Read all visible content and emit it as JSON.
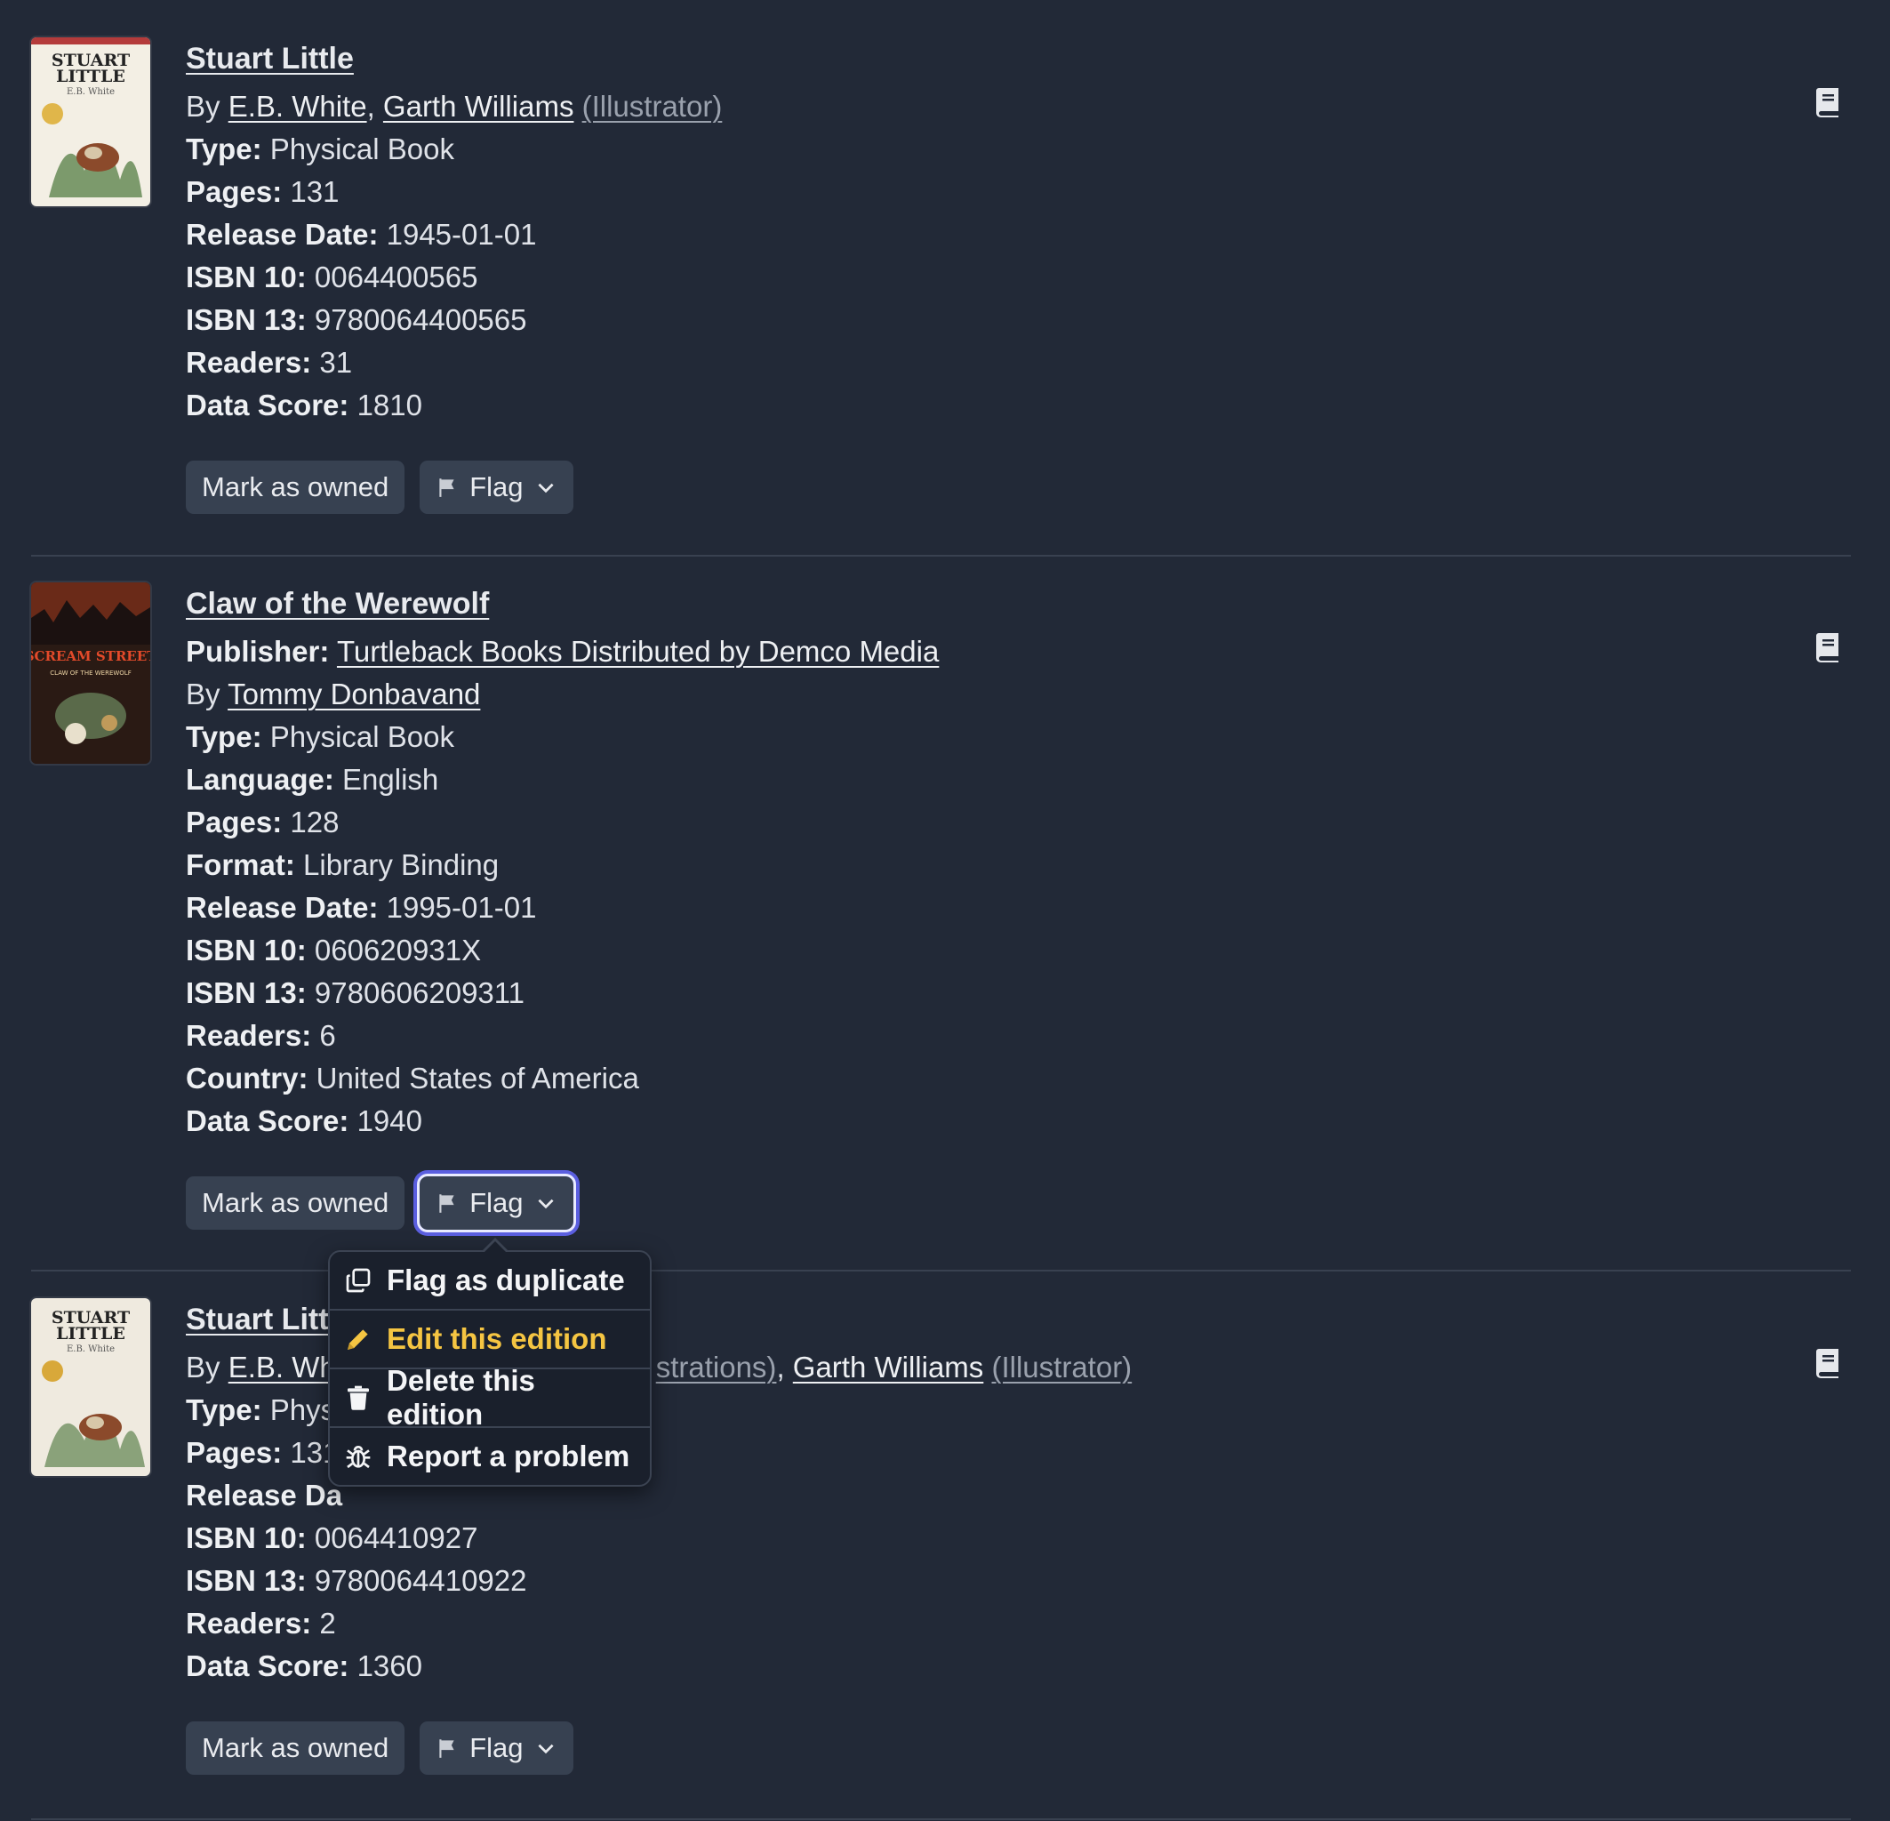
{
  "editions": [
    {
      "title": "Stuart Little",
      "by_label": "By",
      "authors": [
        {
          "name": "E.B. White",
          "role": ""
        },
        {
          "name": "Garth Williams",
          "role": "(Illustrator)"
        }
      ],
      "fields": [
        {
          "label": "Type:",
          "value": "Physical Book"
        },
        {
          "label": "Pages:",
          "value": "131"
        },
        {
          "label": "Release Date:",
          "value": "1945-01-01"
        },
        {
          "label": "ISBN 10:",
          "value": "0064400565"
        },
        {
          "label": "ISBN 13:",
          "value": "9780064400565"
        },
        {
          "label": "Readers:",
          "value": "31"
        },
        {
          "label": "Data Score:",
          "value": "1810"
        }
      ],
      "cover_text": {
        "line1": "STUART",
        "line2": "LITTLE",
        "author": "E.B. White"
      }
    },
    {
      "title": "Claw of the Werewolf",
      "publisher_label": "Publisher:",
      "publisher": "Turtleback Books Distributed by Demco Media",
      "by_label": "By",
      "authors": [
        {
          "name": "Tommy Donbavand",
          "role": ""
        }
      ],
      "fields": [
        {
          "label": "Type:",
          "value": "Physical Book"
        },
        {
          "label": "Language:",
          "value": "English"
        },
        {
          "label": "Pages:",
          "value": "128"
        },
        {
          "label": "Format:",
          "value": "Library Binding"
        },
        {
          "label": "Release Date:",
          "value": "1995-01-01"
        },
        {
          "label": "ISBN 10:",
          "value": "060620931X"
        },
        {
          "label": "ISBN 13:",
          "value": "9780606209311"
        },
        {
          "label": "Readers:",
          "value": "6"
        },
        {
          "label": "Country:",
          "value": "United States of America"
        },
        {
          "label": "Data Score:",
          "value": "1940"
        }
      ],
      "cover_text": {
        "line1": "SCREAM STREET",
        "line2": "CLAW OF THE WEREWOLF"
      }
    },
    {
      "title": "Stuart Littl",
      "by_label": "By",
      "authors_visible": [
        {
          "name": "E.B. Wh",
          "role": "strations)"
        },
        {
          "name": "Garth Williams",
          "role": "(Illustrator)"
        }
      ],
      "fields": [
        {
          "label": "Type:",
          "value": "Phys"
        },
        {
          "label": "Pages:",
          "value": "131"
        },
        {
          "label": "Release Da",
          "value": ""
        },
        {
          "label": "ISBN 10:",
          "value": "0064410927"
        },
        {
          "label": "ISBN 13:",
          "value": "9780064410922"
        },
        {
          "label": "Readers:",
          "value": "2"
        },
        {
          "label": "Data Score:",
          "value": "1360"
        }
      ],
      "cover_text": {
        "line1": "STUART",
        "line2": "LITTLE",
        "author": "E.B. White"
      }
    }
  ],
  "actions": {
    "mark_owned": "Mark as owned",
    "flag": "Flag"
  },
  "flag_menu": {
    "items": [
      {
        "label": "Flag as duplicate",
        "icon": "duplicate-icon"
      },
      {
        "label": "Edit this edition",
        "icon": "pencil-icon"
      },
      {
        "label": "Delete this edition",
        "icon": "trash-icon"
      },
      {
        "label": "Report a problem",
        "icon": "bug-icon"
      }
    ]
  },
  "colors": {
    "background": "#222937",
    "button": "#374151",
    "highlight": "#f5c542",
    "focus_ring": "#5b5fe0"
  }
}
